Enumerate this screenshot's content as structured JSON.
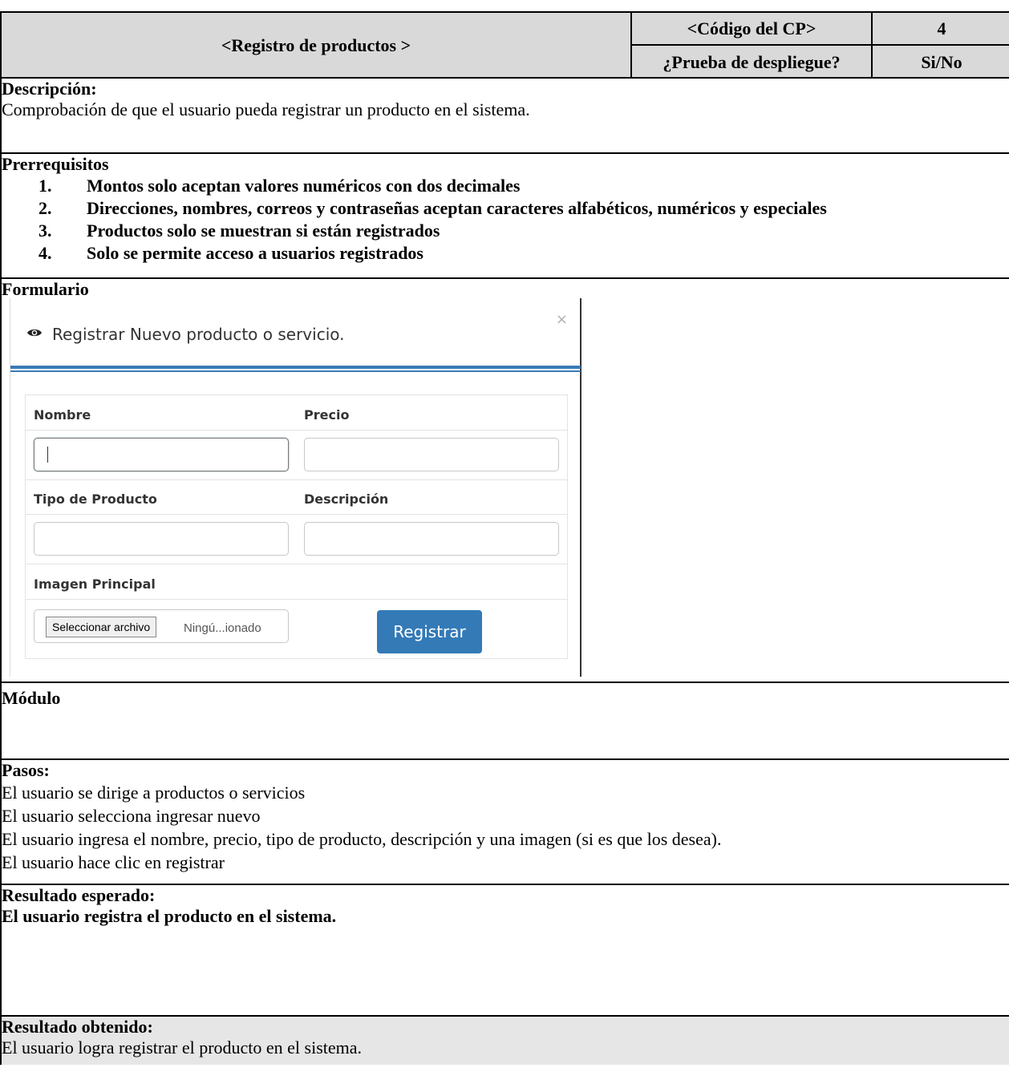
{
  "header": {
    "title": "<Registro de productos >",
    "code_label": "<Código del CP>",
    "code_value": "4",
    "deploy_label": "¿Prueba de despliegue?",
    "deploy_value": "Si/No"
  },
  "descripcion": {
    "label": "Descripción:",
    "text": "Comprobación de que el usuario pueda registrar un producto en el sistema."
  },
  "prerrequisitos": {
    "label": "Prerrequisitos",
    "items": [
      {
        "num": "1.",
        "text": "Montos solo aceptan valores numéricos con dos decimales"
      },
      {
        "num": "2.",
        "text": "Direcciones, nombres, correos y contraseñas aceptan caracteres alfabéticos, numéricos y especiales"
      },
      {
        "num": "3.",
        "text": "Productos solo se muestran si están registrados"
      },
      {
        "num": "4.",
        "text": "Solo se permite acceso a usuarios registrados"
      }
    ]
  },
  "formulario": {
    "label": "Formulario",
    "modal_title": "Registrar Nuevo producto o servicio.",
    "close": "×",
    "fields": {
      "nombre": "Nombre",
      "precio": "Precio",
      "tipo": "Tipo de Producto",
      "descripcion": "Descripción",
      "imagen": "Imagen Principal"
    },
    "file_button": "Seleccionar archivo",
    "file_status": "Ningú...ionado",
    "submit": "Registrar",
    "accent": "#337ab7"
  },
  "modulo": {
    "label": "Módulo"
  },
  "pasos": {
    "label": "Pasos:",
    "steps": [
      "El usuario se dirige a productos o servicios",
      "El usuario selecciona ingresar nuevo",
      "El usuario ingresa el nombre, precio, tipo de producto, descripción y una imagen (si es que los desea).",
      "El usuario hace clic en registrar"
    ]
  },
  "resultado_esperado": {
    "label": "Resultado esperado:",
    "text": "El usuario registra el producto en el sistema."
  },
  "resultado_obtenido": {
    "label": "Resultado obtenido:",
    "text": "El usuario logra registrar el producto en el sistema."
  }
}
